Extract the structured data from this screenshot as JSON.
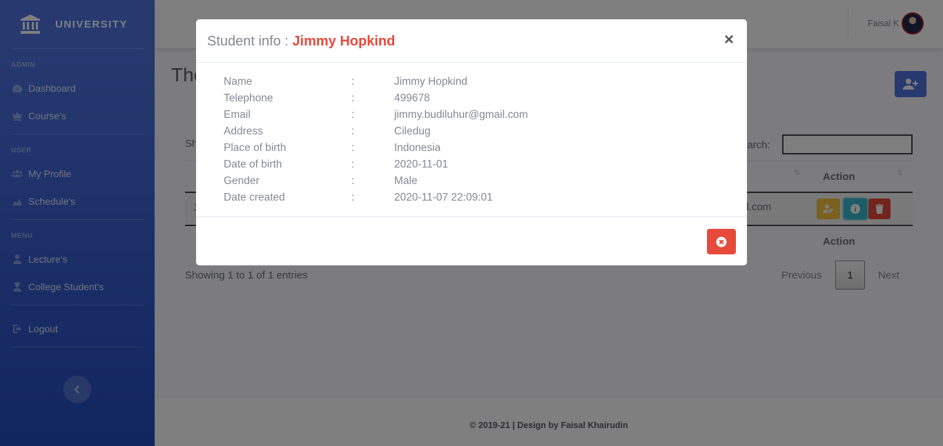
{
  "brand": {
    "name": "UNIVERSITY",
    "icon": "university-icon"
  },
  "sidebar": {
    "sections": [
      {
        "heading": "ADMIN",
        "items": [
          {
            "label": "Dashboard",
            "icon": "tachometer-icon"
          },
          {
            "label": "Course's",
            "icon": "crown-icon"
          }
        ]
      },
      {
        "heading": "USER",
        "items": [
          {
            "label": "My Profile",
            "icon": "users-icon"
          },
          {
            "label": "Schedule's",
            "icon": "chart-area-icon"
          }
        ]
      },
      {
        "heading": "MENU",
        "items": [
          {
            "label": "Lecture's",
            "icon": "user-icon"
          },
          {
            "label": "College Student's",
            "icon": "user-graduate-icon"
          }
        ]
      }
    ],
    "logout": "Logout"
  },
  "topbar": {
    "user_name": "Faisal K"
  },
  "page": {
    "title_fragment": "The",
    "show_fragment": "Sh",
    "search_label": "earch:",
    "search_value": ""
  },
  "table": {
    "action_header": "Action",
    "row_number": "1",
    "email_fragment": "il.com",
    "action_footer": "Action",
    "sort_icon": "⇅"
  },
  "pagination": {
    "info": "Showing 1 to 1 of 1 entries",
    "previous": "Previous",
    "current": "1",
    "next": "Next"
  },
  "footer": {
    "text": "© 2019-21 | Design by Faisal Khairudin"
  },
  "modal": {
    "title_prefix": "Student info :",
    "title_name": "Jimmy Hopkind",
    "close": "×",
    "separator": ":",
    "fields": [
      {
        "label": "Name",
        "value": "Jimmy Hopkind"
      },
      {
        "label": "Telephone",
        "value": "499678"
      },
      {
        "label": "Email",
        "value": "jimmy.budiluhur@gmail.com"
      },
      {
        "label": "Address",
        "value": "Ciledug"
      },
      {
        "label": "Place of birth",
        "value": "Indonesia"
      },
      {
        "label": "Date of birth",
        "value": "2020-11-01"
      },
      {
        "label": "Gender",
        "value": "Male"
      },
      {
        "label": "Date created",
        "value": "2020-11-07 22:09:01"
      }
    ]
  },
  "colors": {
    "primary": "#4e73df",
    "danger": "#e74a3b",
    "warning": "#f6c23e",
    "info": "#36b9cc"
  }
}
